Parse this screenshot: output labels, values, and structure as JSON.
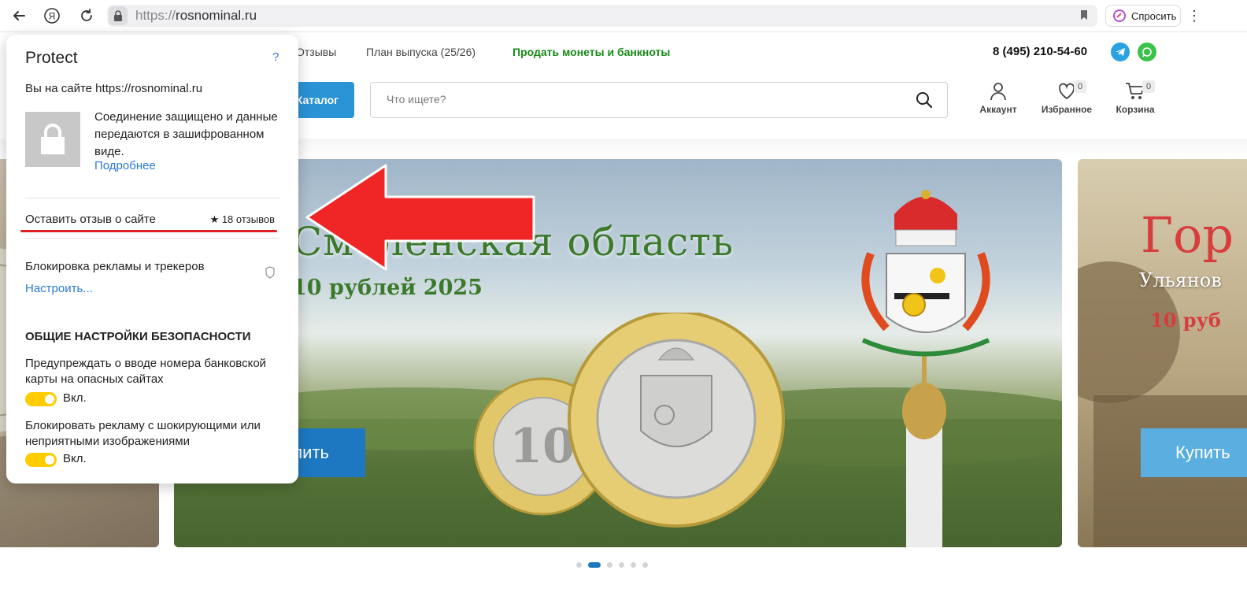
{
  "browser": {
    "url_protocol": "https://",
    "url_host": "rosnominal.ru",
    "ask_label": "Спросить",
    "yandex_glyph": "Я"
  },
  "site": {
    "nav": [
      "Отзывы",
      "План выпуска (25/26)"
    ],
    "sell_link": "Продать монеты и банкноты",
    "phone": "8 (495) 210-54-60",
    "catalog_label": "Каталог",
    "search_placeholder": "Что ищете?",
    "account_label": "Аккаунт",
    "favorites_label": "Избранное",
    "favorites_count": "0",
    "cart_label": "Корзина",
    "cart_count": "0"
  },
  "hero": {
    "title": "Смоленская область",
    "subtitle": "10 рублей 2025",
    "buy_label": "Купить",
    "right_title": "Гор",
    "right_sub": "Ульянов",
    "right_price": "10 руб",
    "right_buy_label": "Купить",
    "slides_total": 6,
    "active_slide": 2
  },
  "popup": {
    "title": "Protect",
    "help": "?",
    "site_text": "Вы на сайте https://rosnominal.ru",
    "secure_text": "Соединение защищено и данные передаются в зашифрованном виде.",
    "more_link": "Подробнее",
    "review_link": "Оставить отзыв о сайте",
    "reviews_count": "★ 18 отзывов",
    "adblock_label": "Блокировка рекламы и трекеров",
    "configure_link": "Настроить...",
    "security_heading": "ОБЩИЕ НАСТРОЙКИ БЕЗОПАСНОСТИ",
    "option1": "Предупреждать о вводе номера банковской карты на опасных сайтах",
    "option1_state": "Вкл.",
    "option2": "Блокировать рекламу с шокирующими или неприятными изображениями",
    "option2_state": "Вкл."
  },
  "colors": {
    "accent_blue": "#2a93d5",
    "link_blue": "#2a7ad5",
    "sell_green": "#178a17",
    "toggle_yellow": "#ffcc00",
    "arrow_red": "#e02020"
  },
  "icons": [
    "back-icon",
    "yandex-icon",
    "reload-icon",
    "lock-icon",
    "bookmark-icon",
    "alice-icon",
    "kebab-icon",
    "telegram-icon",
    "whatsapp-icon",
    "search-icon",
    "account-icon",
    "heart-icon",
    "cart-icon",
    "shield-icon",
    "red-arrow-icon"
  ]
}
